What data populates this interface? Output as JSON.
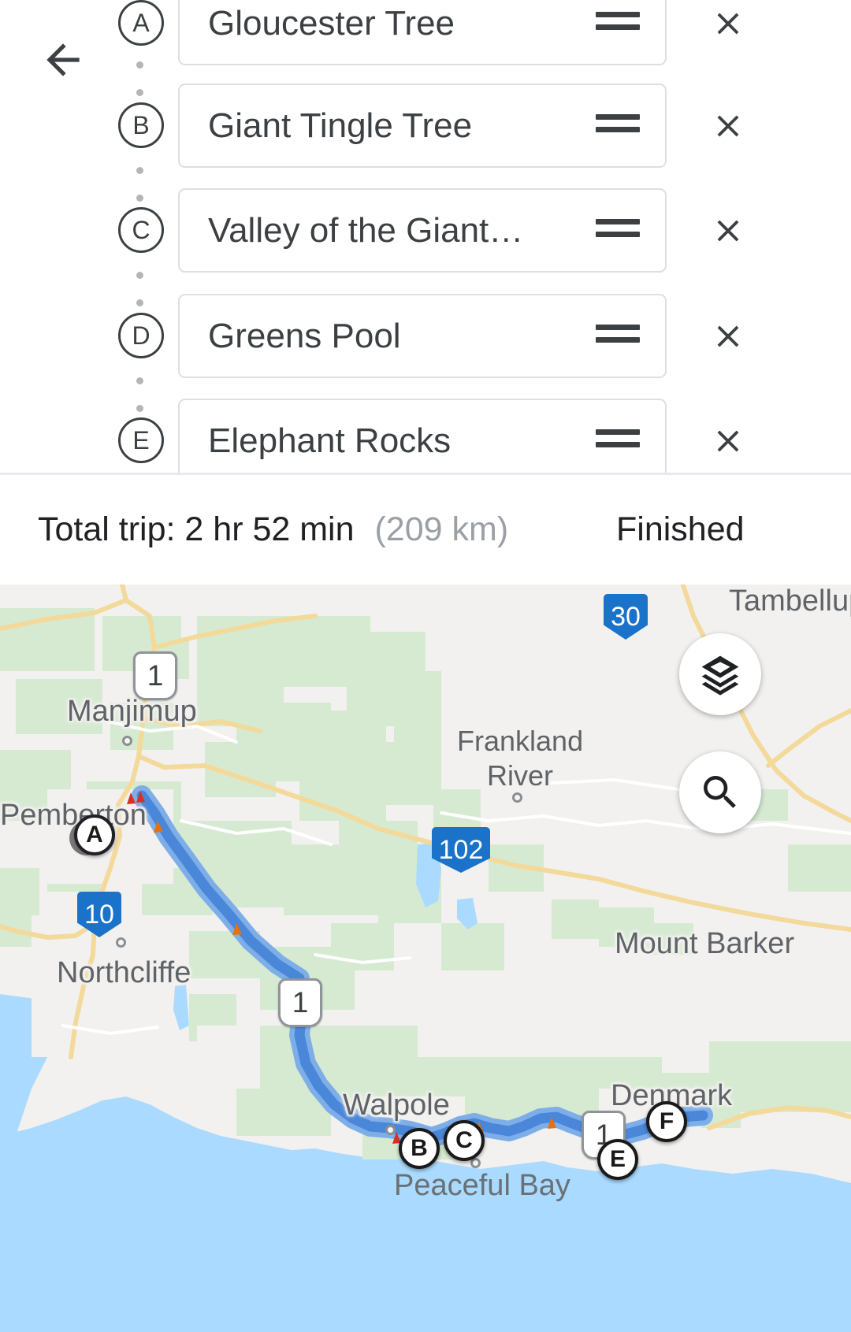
{
  "header": {
    "back_icon": "arrow-left-icon"
  },
  "waypoints": {
    "items": [
      {
        "badge": "A",
        "label": "Gloucester Tree",
        "drag_icon": "drag-handle-icon",
        "remove_icon": "close-icon"
      },
      {
        "badge": "B",
        "label": "Giant Tingle Tree",
        "drag_icon": "drag-handle-icon",
        "remove_icon": "close-icon"
      },
      {
        "badge": "C",
        "label": "Valley of the Giant…",
        "drag_icon": "drag-handle-icon",
        "remove_icon": "close-icon"
      },
      {
        "badge": "D",
        "label": "Greens Pool",
        "drag_icon": "drag-handle-icon",
        "remove_icon": "close-icon"
      },
      {
        "badge": "E",
        "label": "Elephant Rocks",
        "drag_icon": "drag-handle-icon",
        "remove_icon": "close-icon"
      }
    ]
  },
  "trip_bar": {
    "summary_prefix": "Total trip:",
    "duration": "2 hr 52 min",
    "distance": "(209 km)",
    "finished_label": "Finished"
  },
  "map": {
    "layers_icon": "layers-icon",
    "search_icon": "search-icon",
    "cities": [
      {
        "name": "Manjimup"
      },
      {
        "name": "Pemberton"
      },
      {
        "name": "Northcliffe"
      },
      {
        "name": "Walpole"
      },
      {
        "name": "Denmark"
      },
      {
        "name": "Mount Barker"
      },
      {
        "name": "Tambellup"
      }
    ],
    "regions": [
      {
        "line1": "Frankland",
        "line2": "River"
      }
    ],
    "water_labels": [
      {
        "name": "Peaceful Bay"
      }
    ],
    "highway_shields": [
      {
        "number": "1",
        "style": "white"
      },
      {
        "number": "1",
        "style": "white"
      },
      {
        "number": "1",
        "style": "white"
      },
      {
        "number": "30",
        "style": "blue"
      },
      {
        "number": "102",
        "style": "blue"
      },
      {
        "number": "10",
        "style": "blue"
      }
    ],
    "route_markers": [
      {
        "badge": "A"
      },
      {
        "badge": "B"
      },
      {
        "badge": "C"
      },
      {
        "badge": "E"
      },
      {
        "badge": "F"
      }
    ],
    "colors": {
      "route": "#4a87d8",
      "route_casing": "#7eaee8",
      "land": "#f2f1ef",
      "forest": "#d6ead2",
      "water": "#aadaff",
      "road_minor": "#f3d99a",
      "shield_blue": "#1a73c8"
    }
  }
}
